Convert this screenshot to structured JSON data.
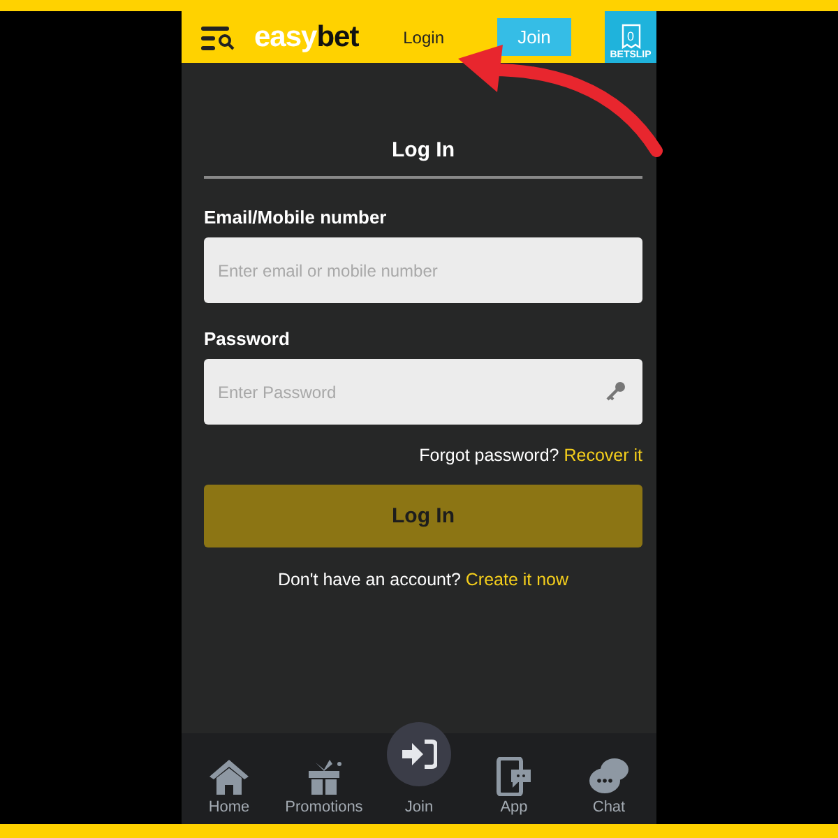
{
  "header": {
    "logo": {
      "light": "easy",
      "dark": "bet"
    },
    "login_link": "Login",
    "join_button": "Join",
    "betslip": {
      "count": "0",
      "label": "BETSLIP"
    }
  },
  "form": {
    "title": "Log In",
    "fields": [
      {
        "label": "Email/Mobile number",
        "placeholder": "Enter email or mobile number",
        "kind": "text"
      },
      {
        "label": "Password",
        "placeholder": "Enter Password",
        "kind": "password"
      }
    ],
    "forgot": {
      "text": "Forgot password?",
      "link": "Recover it"
    },
    "submit": "Log In",
    "signup": {
      "text": "Don't have an account?",
      "link": "Create it now"
    }
  },
  "bottom_nav": [
    {
      "label": "Home",
      "kind": "home"
    },
    {
      "label": "Promotions",
      "kind": "gift"
    },
    {
      "label": "Join",
      "kind": "join"
    },
    {
      "label": "App",
      "kind": "app"
    },
    {
      "label": "Chat",
      "kind": "chat"
    }
  ]
}
